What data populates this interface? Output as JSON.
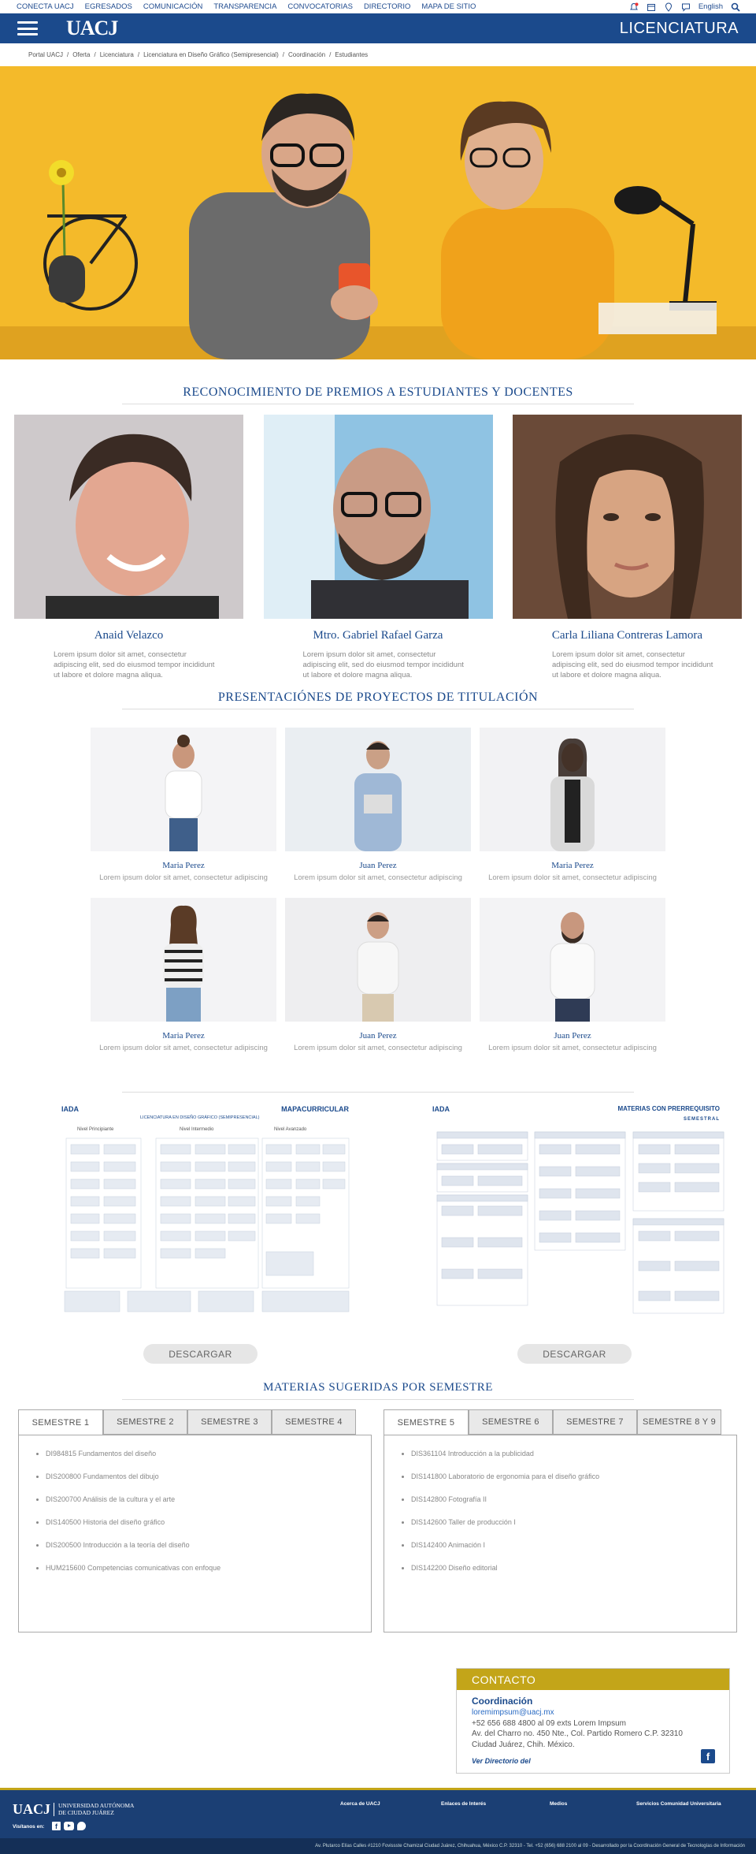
{
  "topbar": {
    "nav": [
      "CONECTA UACJ",
      "EGRESADOS",
      "COMUNICACIÓN",
      "TRANSPARENCIA",
      "CONVOCATORIAS",
      "DIRECTORIO",
      "MAPA DE SITIO"
    ],
    "language": "English"
  },
  "header": {
    "logo": "UACJ",
    "title": "LICENCIATURA"
  },
  "breadcrumb": [
    "Portal UACJ",
    "Oferta",
    "Licenciatura",
    "Licenciatura en Diseño Gráfico (Semipresencial)",
    "Coordinación",
    "Estudiantes"
  ],
  "awards": {
    "title": "RECONOCIMIENTO DE PREMIOS A ESTUDIANTES Y DOCENTES",
    "items": [
      {
        "name": "Anaid Velazco",
        "desc": "Lorem ipsum dolor sit amet, consectetur adipiscing elit, sed do eiusmod tempor incididunt ut labore et dolore magna aliqua."
      },
      {
        "name": "Mtro. Gabriel Rafael Garza",
        "desc": "Lorem ipsum dolor sit amet, consectetur adipiscing elit, sed do eiusmod tempor incididunt ut labore et dolore magna aliqua."
      },
      {
        "name": "Carla Liliana Contreras Lamora",
        "desc": "Lorem ipsum dolor sit amet, consectetur adipiscing elit, sed do eiusmod tempor incididunt ut labore et dolore magna aliqua."
      }
    ]
  },
  "projects": {
    "title": "PRESENTACIÓNES DE PROYECTOS DE TITULACIÓN",
    "items": [
      {
        "name": "Maria Perez",
        "desc": "Lorem ipsum dolor sit amet, consectetur adipiscing"
      },
      {
        "name": "Juan Perez",
        "desc": "Lorem ipsum dolor sit amet, consectetur adipiscing"
      },
      {
        "name": "Maria Perez",
        "desc": "Lorem ipsum dolor sit amet, consectetur adipiscing"
      },
      {
        "name": "Maria Perez",
        "desc": "Lorem ipsum dolor sit amet, consectetur adipiscing"
      },
      {
        "name": "Juan Perez",
        "desc": "Lorem ipsum dolor sit amet, consectetur adipiscing"
      },
      {
        "name": "Juan Perez",
        "desc": "Lorem ipsum dolor sit amet, consectetur adipiscing"
      }
    ]
  },
  "maps": {
    "left": {
      "brand": "IADA",
      "heading": "MAPACURRICULAR",
      "subtitle": "LICENCIATURA EN DISEÑO GRÁFICO (SEMIPRESENCIAL)",
      "levels": [
        "Nivel Principiante",
        "Nivel Intermedio",
        "Nivel Avanzado"
      ],
      "download": "DESCARGAR"
    },
    "right": {
      "brand": "IADA",
      "heading": "MATERIAS CON PRERREQUISITO",
      "tag": "SEMESTRAL",
      "download": "DESCARGAR"
    }
  },
  "semesters": {
    "title": "MATERIAS SUGERIDAS POR SEMESTRE",
    "left": {
      "tabs": [
        "SEMESTRE 1",
        "SEMESTRE 2",
        "SEMESTRE 3",
        "SEMESTRE 4"
      ],
      "items": [
        "DI984815 Fundamentos del diseño",
        "DIS200800 Fundamentos del dibujo",
        "DIS200700 Análisis de la cultura y el arte",
        "DIS140500 Historia del diseño gráfico",
        "DIS200500 Introducción a la teoría del diseño",
        "HUM215600 Competencias comunicativas con enfoque"
      ]
    },
    "right": {
      "tabs": [
        "SEMESTRE 5",
        "SEMESTRE 6",
        "SEMESTRE 7",
        "SEMESTRE 8 Y 9"
      ],
      "items": [
        "DIS361104 Introducción a la publicidad",
        "DIS141800 Laboratorio de ergonomia para el diseño gráfico",
        "DIS142800 Fotografía II",
        "DIS142600 Taller de producción I",
        "DIS142400 Animación I",
        "DIS142200 Diseño editorial"
      ]
    }
  },
  "contact": {
    "header": "CONTACTO",
    "title": "Coordinación",
    "email": "loremimpsum@uacj.mx",
    "phone": "+52 656 688 4800 al 09 exts Lorem Impsum",
    "address1": "Av. del Charro no. 450 Nte., Col. Partido Romero C.P. 32310",
    "address2": "Ciudad Juárez, Chih. México.",
    "directory_link": "Ver Directorio del"
  },
  "footer": {
    "logo": "UACJ",
    "university": "Universidad Autónoma de Ciudad Juárez",
    "visit": "Visítanos en:",
    "links": [
      "Acerca de UACJ",
      "Enlaces de Interés",
      "Medios",
      "Servicios Comunidad Universitaria"
    ],
    "legal": "Av. Plutarco Elías Calles #1210 Fovissste Chamizal Ciudad Juárez, Chihuahua, México C.P. 32310 - Tel. +52 (656) 688 2100 al 09 - Desarrollado por la Coordinación General de Tecnologías de Información"
  }
}
